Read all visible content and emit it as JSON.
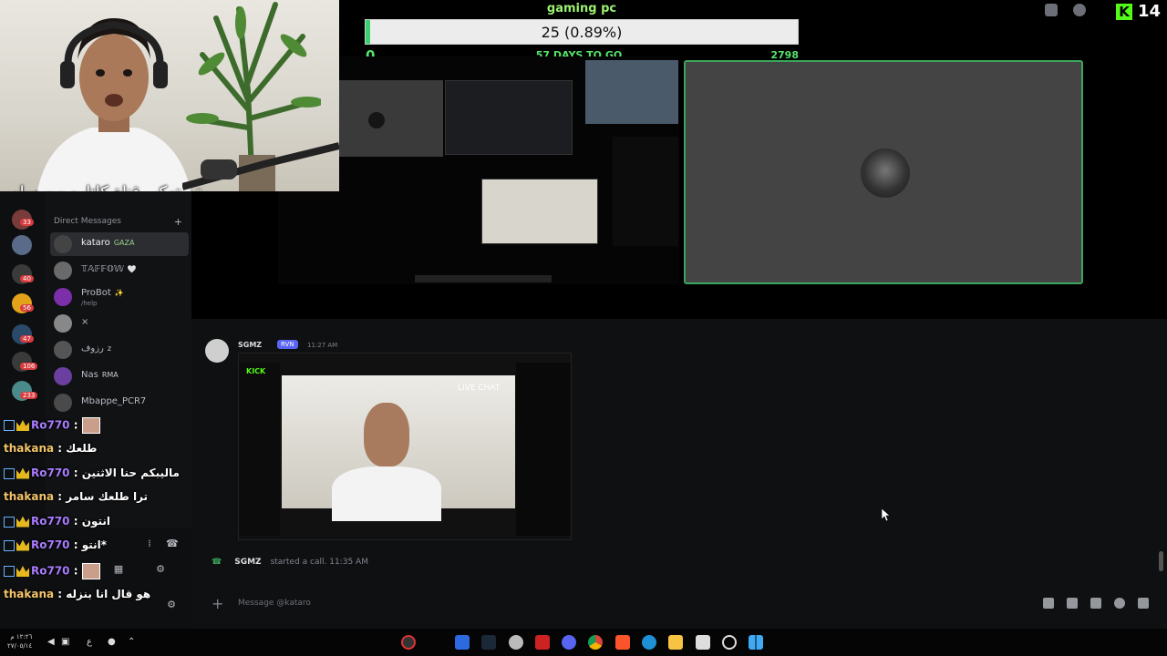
{
  "goal": {
    "title": "gaming pc",
    "progress_text": "25 (0.89%)",
    "progress_fraction": 0.0089,
    "min": "0",
    "days_left": "57 DAYS TO GO",
    "max": "2798"
  },
  "viewer_count": "14",
  "webcam_caption": "تم تهكير قناة كاتارو من سامر",
  "dm": {
    "header": "Direct Messages",
    "items": [
      {
        "name": "kataro",
        "tag": "GAZA",
        "active": true
      },
      {
        "name": "𝕋𝔸𝔽𝔽𝕆𝕎",
        "tag": "🤍"
      },
      {
        "name": "ProBot",
        "tag": "✨",
        "sub": "/help"
      },
      {
        "name": "×",
        "tag": ""
      },
      {
        "name": "رزوف",
        "tag": "z"
      },
      {
        "name": "Nas",
        "tag": "RMA"
      },
      {
        "name": "Mbappe_PCR7",
        "tag": ""
      }
    ]
  },
  "stream_chat": [
    {
      "user": "Ro770",
      "msg": "",
      "type": "ro",
      "emote": true
    },
    {
      "user": "thakana",
      "msg": "طلعك",
      "type": "th"
    },
    {
      "user": "Ro770",
      "msg": "ماليبكم حنا الاثنين",
      "type": "ro"
    },
    {
      "user": "thakana",
      "msg": "ترا طلعك سامر",
      "type": "th"
    },
    {
      "user": "Ro770",
      "msg": "انتون",
      "type": "ro"
    },
    {
      "user": "Ro770",
      "msg": "انتو*",
      "type": "ro"
    },
    {
      "user": "Ro770",
      "msg": "",
      "type": "ro",
      "emote": true
    },
    {
      "user": "thakana",
      "msg": "هو قال انا بنزله",
      "type": "th"
    }
  ],
  "message": {
    "author": "SGMZ",
    "role": "RVN",
    "time": "11:27 AM",
    "live_chat": "LIVE CHAT",
    "kick": "KICK"
  },
  "call_event": {
    "author": "SGMZ",
    "text": "started a call.",
    "time": "11:35 AM"
  },
  "input": {
    "placeholder": "Message @kataro"
  },
  "taskbar": {
    "time": "١٢:٢٦ م",
    "date": "٢٧/٠٥/١٤"
  },
  "colors": {
    "accent_green": "#3ba55c",
    "kick_green": "#53fc18",
    "discord_blurple": "#5865f2"
  }
}
